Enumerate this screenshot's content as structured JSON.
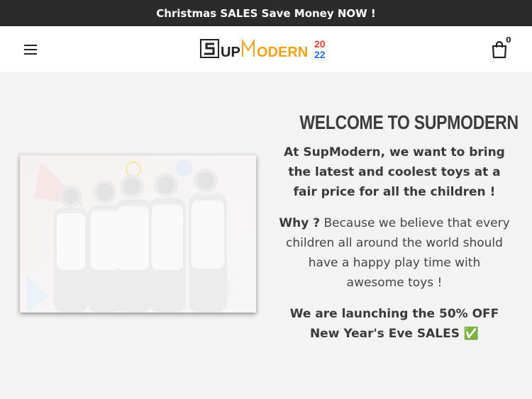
{
  "announcement": {
    "text": "Christmas SALES Save Money NOW !"
  },
  "header": {
    "menu_icon": "hamburger-menu-icon",
    "logo": {
      "text": "SUPMODERN",
      "year": "2022"
    },
    "cart_icon": "shopping-bag-icon",
    "cart_count": "0"
  },
  "hero": {
    "image_alt": "group-of-kids-in-white-tshirts"
  },
  "content": {
    "heading": "WELCOME TO SUPMODERN",
    "paragraph1": "At SupModern, we want to bring the latest and coolest toys at a fair price for all the children !",
    "paragraph2_lead": "Why ?",
    "paragraph2_rest": " Because we believe that every children all around the world should have a happy play time with awesome toys !",
    "paragraph3": "We are launching the    50% OFF New Year's Eve SALES ",
    "check_icon": "✅"
  },
  "colors": {
    "announcement_bg": "#2b2b2b",
    "page_bg": "#f3f3f3",
    "logo_orange": "#f4a11b",
    "logo_red": "#e8412f",
    "logo_blue": "#2d6fd6"
  }
}
